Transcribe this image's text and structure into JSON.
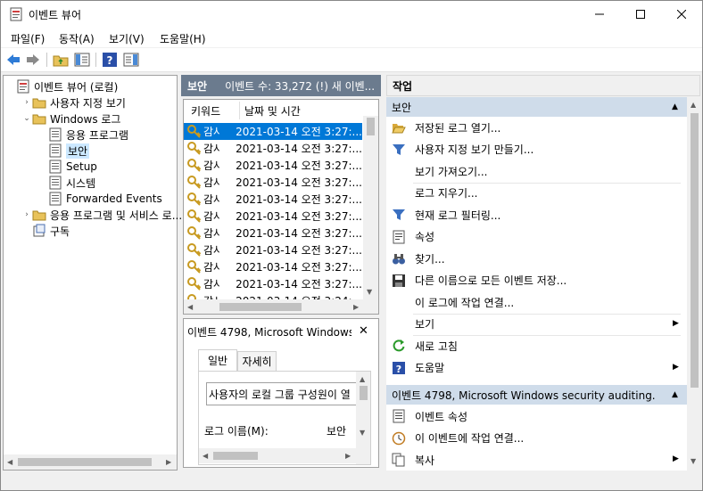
{
  "window": {
    "title": "이벤트 뷰어"
  },
  "menu": [
    "파일(F)",
    "동작(A)",
    "보기(V)",
    "도움말(H)"
  ],
  "tree": {
    "items": [
      {
        "label": "이벤트 뷰어 (로컬)",
        "level": 0,
        "expand": "",
        "icon": "event-viewer-icon"
      },
      {
        "label": "사용자 지정 보기",
        "level": 1,
        "expand": "›",
        "icon": "folder-icon"
      },
      {
        "label": "Windows 로그",
        "level": 1,
        "expand": "⌄",
        "icon": "folder-icon"
      },
      {
        "label": "응용 프로그램",
        "level": 2,
        "expand": "",
        "icon": "log-icon"
      },
      {
        "label": "보안",
        "level": 2,
        "expand": "",
        "icon": "log-icon",
        "selected": true
      },
      {
        "label": "Setup",
        "level": 2,
        "expand": "",
        "icon": "log-icon"
      },
      {
        "label": "시스템",
        "level": 2,
        "expand": "",
        "icon": "log-icon"
      },
      {
        "label": "Forwarded Events",
        "level": 2,
        "expand": "",
        "icon": "log-icon"
      },
      {
        "label": "응용 프로그램 및 서비스 로...",
        "level": 1,
        "expand": "›",
        "icon": "folder-icon"
      },
      {
        "label": "구독",
        "level": 1,
        "expand": "",
        "icon": "subscription-icon"
      }
    ]
  },
  "events_panel": {
    "title": "보안",
    "count_text": "이벤트 수: 33,272 (!) 새 이벤...",
    "columns": {
      "keyword": "키워드",
      "datetime": "날짜 및 시간"
    },
    "rows": [
      {
        "keyword": "감사...",
        "datetime": "2021-03-14 오전 3:27:..."
      },
      {
        "keyword": "감사...",
        "datetime": "2021-03-14 오전 3:27:..."
      },
      {
        "keyword": "감사...",
        "datetime": "2021-03-14 오전 3:27:..."
      },
      {
        "keyword": "감사...",
        "datetime": "2021-03-14 오전 3:27:..."
      },
      {
        "keyword": "감사...",
        "datetime": "2021-03-14 오전 3:27:..."
      },
      {
        "keyword": "감사...",
        "datetime": "2021-03-14 오전 3:27:..."
      },
      {
        "keyword": "감사...",
        "datetime": "2021-03-14 오전 3:27:..."
      },
      {
        "keyword": "감사...",
        "datetime": "2021-03-14 오전 3:27:..."
      },
      {
        "keyword": "감사...",
        "datetime": "2021-03-14 오전 3:27:..."
      },
      {
        "keyword": "감사...",
        "datetime": "2021-03-14 오전 3:27:..."
      },
      {
        "keyword": "감사...",
        "datetime": "2021-03-14 오전 3:24:..."
      }
    ]
  },
  "detail": {
    "title": "이벤트 4798, Microsoft Windows",
    "tabs": [
      "일반",
      "자세히"
    ],
    "description": "사용자의 로컬 그룹 구성원이 열",
    "field_label": "로그 이름(M):",
    "field_value": "보안"
  },
  "actions": {
    "header": "작업",
    "section1_title": "보안",
    "section1_items": [
      {
        "label": "저장된 로그 열기...",
        "icon": "open-folder-icon",
        "submenu": false
      },
      {
        "label": "사용자 지정 보기 만들기...",
        "icon": "filter-icon",
        "submenu": false
      },
      {
        "label": "보기 가져오기...",
        "icon": "",
        "submenu": false
      },
      {
        "label": "로그 지우기...",
        "icon": "",
        "submenu": false
      },
      {
        "label": "현재 로그 필터링...",
        "icon": "filter-icon",
        "submenu": false
      },
      {
        "label": "속성",
        "icon": "properties-icon",
        "submenu": false
      },
      {
        "label": "찾기...",
        "icon": "binoculars-icon",
        "submenu": false
      },
      {
        "label": "다른 이름으로 모든 이벤트 저장...",
        "icon": "save-icon",
        "submenu": false
      },
      {
        "label": "이 로그에 작업 연결...",
        "icon": "",
        "submenu": false
      },
      {
        "label": "보기",
        "icon": "",
        "submenu": true
      },
      {
        "label": "새로 고침",
        "icon": "refresh-icon",
        "submenu": false
      },
      {
        "label": "도움말",
        "icon": "help-icon",
        "submenu": true
      }
    ],
    "section2_title": "이벤트 4798, Microsoft Windows security auditing.",
    "section2_items": [
      {
        "label": "이벤트 속성",
        "icon": "event-properties-icon",
        "submenu": false
      },
      {
        "label": "이 이벤트에 작업 연결...",
        "icon": "task-icon",
        "submenu": false
      },
      {
        "label": "복사",
        "icon": "copy-icon",
        "submenu": true
      }
    ]
  },
  "colors": {
    "selection": "#0078d7",
    "header_bg": "#6b7b8e",
    "section_bg": "#cfdcea",
    "tree_selection": "#cce8ff"
  }
}
